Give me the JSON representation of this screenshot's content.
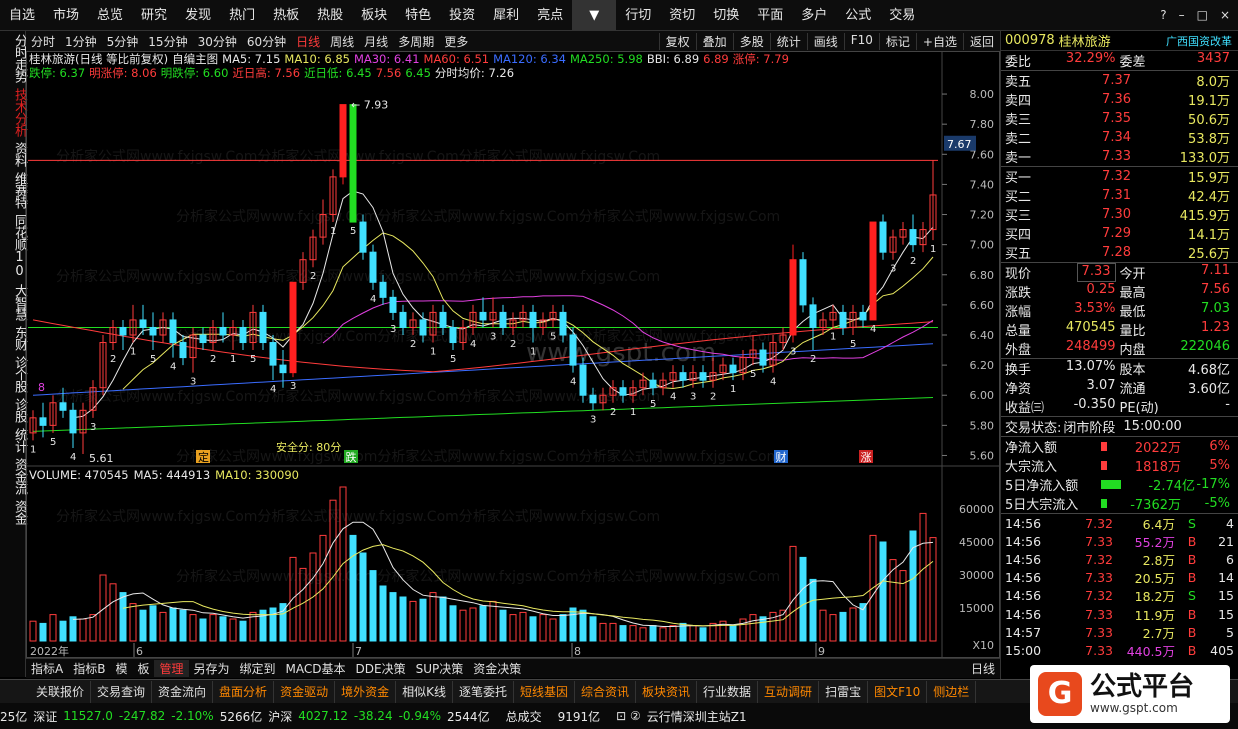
{
  "top_menu": [
    "自选",
    "市场",
    "总览",
    "研究",
    "发现",
    "热门",
    "热板",
    "热股",
    "板块",
    "特色",
    "投资",
    "犀利",
    "亮点",
    "▼",
    "行切",
    "资切",
    "切换",
    "平面",
    "多户",
    "公式",
    "交易"
  ],
  "window_controls": [
    "?",
    "–",
    "□",
    "×"
  ],
  "side_tabs": [
    "分时走势",
    "技术分析",
    "资料",
    "维赛特",
    "同花顺10",
    "大智慧",
    "东财",
    "诊个股",
    "诊股",
    "统计",
    "资金流",
    "资金"
  ],
  "period_bar": {
    "items": [
      "分时",
      "1分钟",
      "5分钟",
      "15分钟",
      "30分钟",
      "60分钟",
      "日线",
      "周线",
      "月线",
      "多周期",
      "更多"
    ],
    "active": "日线",
    "right_tools": [
      "复权",
      "叠加",
      "多股",
      "统计",
      "画线",
      "F10",
      "标记",
      "+自选",
      "返回"
    ]
  },
  "chart_info": {
    "line1": [
      {
        "t": "桂林旅游(日线 等比前复权)",
        "c": "#e8e8e8"
      },
      {
        "t": "自编主图",
        "c": "#e8e8e8"
      },
      {
        "t": "MA5: 7.15",
        "c": "#e8e8e8"
      },
      {
        "t": "MA10: 6.85",
        "c": "#e8e860"
      },
      {
        "t": "MA30: 6.41",
        "c": "#e040e0"
      },
      {
        "t": "MA60: 6.51",
        "c": "#ff3c3c"
      },
      {
        "t": "MA120: 6.34",
        "c": "#3a6cff"
      },
      {
        "t": "MA250: 5.98",
        "c": "#22dd22"
      },
      {
        "t": "BBI: 6.89",
        "c": "#e8e8e8"
      },
      {
        "t": "6.89",
        "c": "#ff3c3c"
      },
      {
        "t": "涨停: 7.79",
        "c": "#ff3c3c"
      }
    ],
    "line2": [
      {
        "t": "跌停: 6.37",
        "c": "#22dd22"
      },
      {
        "t": "明涨停: 8.06",
        "c": "#ff3c3c"
      },
      {
        "t": "明跌停: 6.60",
        "c": "#22dd22"
      },
      {
        "t": "近日高: 7.56",
        "c": "#ff3c3c"
      },
      {
        "t": "近日低: 6.45",
        "c": "#22dd22"
      },
      {
        "t": "7.56",
        "c": "#ff3c3c"
      },
      {
        "t": "6.45",
        "c": "#22dd22"
      },
      {
        "t": "分时均价: 7.26",
        "c": "#e8e8e8"
      }
    ]
  },
  "annotations": {
    "high_label": "7.93",
    "low_label": "5.61",
    "safety": "安全分: 80分",
    "diedie": "跌",
    "cai": "财",
    "zhang": "涨",
    "ding": "定",
    "plus_high": "8",
    "year": "2022年",
    "months": [
      "6",
      "7",
      "8",
      "9"
    ]
  },
  "price_axis": [
    "8.00",
    "7.80",
    "7.60",
    "7.40",
    "7.20",
    "7.00",
    "6.80",
    "6.60",
    "6.40",
    "6.20",
    "6.00",
    "5.80",
    "5.60"
  ],
  "current_price_tag": "7.67",
  "volume_axis": [
    "60000",
    "45000",
    "30000",
    "15000",
    "X10"
  ],
  "volume_legend": [
    {
      "t": "VOLUME: 470545",
      "c": "#e8e8e8"
    },
    {
      "t": "MA5: 444913",
      "c": "#e8e8e8"
    },
    {
      "t": "MA10: 330090",
      "c": "#e8e860"
    }
  ],
  "watermark_text": "分析家公式网www.fxjgsw.Com",
  "center_watermark": "www.gspt.com",
  "sub_tabs": [
    "指标A",
    "指标B",
    "模",
    "板",
    "管理",
    "另存为",
    "绑定到",
    "MACD基本",
    "DDE决策",
    "SUP决策",
    "资金决策"
  ],
  "sub_tabs_active": "管理",
  "day_label": "日线",
  "bottom_bar": [
    "关联报价",
    "交易查询",
    "资金流向",
    "盘面分析",
    "资金驱动",
    "境外资金",
    "相似K线",
    "逐笔委托",
    "短线基因",
    "综合资讯",
    "板块资讯",
    "行业数据",
    "互动调研",
    "扫雷宝",
    "图文F10",
    "侧边栏"
  ],
  "bottom_bar_highlight": [
    "盘面分析",
    "资金驱动",
    "境外资金",
    "短线基因",
    "综合资讯",
    "板块资讯",
    "互动调研",
    "图文F10",
    "侧边栏"
  ],
  "status": {
    "a": "25亿",
    "sz_label": "深证",
    "sz_val": "11527.0",
    "sz_chg": "-247.82",
    "sz_pct": "-2.10%",
    "sz_amt": "5266亿",
    "sh_label": "沪深",
    "sh_val": "4027.12",
    "sh_chg": "-38.24",
    "sh_pct": "-0.94%",
    "sh_amt": "2544亿",
    "total_label": "总成交",
    "total": "9191亿",
    "server": "云行情深圳主站Z1"
  },
  "quote": {
    "code": "000978",
    "name": "桂林旅游",
    "tag": "广西国资改革",
    "weibi_label": "委比",
    "weibi": "32.29%",
    "weicha_label": "委差",
    "weicha": "3437",
    "sell": [
      {
        "l": "卖五",
        "p": "7.37",
        "v": "8.0万"
      },
      {
        "l": "卖四",
        "p": "7.36",
        "v": "19.1万"
      },
      {
        "l": "卖三",
        "p": "7.35",
        "v": "50.6万"
      },
      {
        "l": "卖二",
        "p": "7.34",
        "v": "53.8万"
      },
      {
        "l": "卖一",
        "p": "7.33",
        "v": "133.0万"
      }
    ],
    "buy": [
      {
        "l": "买一",
        "p": "7.32",
        "v": "15.9万"
      },
      {
        "l": "买二",
        "p": "7.31",
        "v": "42.4万"
      },
      {
        "l": "买三",
        "p": "7.30",
        "v": "415.9万"
      },
      {
        "l": "买四",
        "p": "7.29",
        "v": "14.1万"
      },
      {
        "l": "买五",
        "p": "7.28",
        "v": "25.6万"
      }
    ],
    "stats": [
      {
        "a": "现价",
        "av": "7.33",
        "ac": "red",
        "b": "今开",
        "bv": "7.11",
        "bc": "red"
      },
      {
        "a": "涨跌",
        "av": "0.25",
        "ac": "red",
        "b": "最高",
        "bv": "7.56",
        "bc": "red"
      },
      {
        "a": "涨幅",
        "av": "3.53%",
        "ac": "red",
        "b": "最低",
        "bv": "7.03",
        "bc": "green"
      },
      {
        "a": "总量",
        "av": "470545",
        "ac": "yel",
        "b": "量比",
        "bv": "1.23",
        "bc": "red"
      },
      {
        "a": "外盘",
        "av": "248499",
        "ac": "red",
        "b": "内盘",
        "bv": "222046",
        "bc": "green"
      }
    ],
    "stats2": [
      {
        "a": "换手",
        "av": "13.07%",
        "b": "股本",
        "bv": "4.68亿"
      },
      {
        "a": "净资",
        "av": "3.07",
        "b": "流通",
        "bv": "3.60亿"
      },
      {
        "a": "收益㈢",
        "av": "-0.350",
        "b": "PE(动)",
        "bv": "-"
      }
    ],
    "trade_state_label": "交易状态:",
    "trade_state": "闭市阶段",
    "trade_time": "15:00:00",
    "flows": [
      {
        "l": "净流入额",
        "v": "2022万",
        "p": "6%",
        "c": "red"
      },
      {
        "l": "大宗流入",
        "v": "1818万",
        "p": "5%",
        "c": "red"
      },
      {
        "l": "5日净流入额",
        "v": "-2.74亿",
        "p": "-17%",
        "c": "green"
      },
      {
        "l": "5日大宗流入",
        "v": "-7362万",
        "p": "-5%",
        "c": "green"
      }
    ],
    "ticks": [
      {
        "t": "14:56",
        "p": "7.32",
        "v": "6.4万",
        "bs": "S",
        "n": "4"
      },
      {
        "t": "14:56",
        "p": "7.33",
        "v": "55.2万",
        "bs": "B",
        "n": "21"
      },
      {
        "t": "14:56",
        "p": "7.32",
        "v": "2.8万",
        "bs": "B",
        "n": "6"
      },
      {
        "t": "14:56",
        "p": "7.33",
        "v": "20.5万",
        "bs": "B",
        "n": "14"
      },
      {
        "t": "14:56",
        "p": "7.32",
        "v": "18.2万",
        "bs": "S",
        "n": "15"
      },
      {
        "t": "14:56",
        "p": "7.33",
        "v": "11.9万",
        "bs": "B",
        "n": "15"
      },
      {
        "t": "14:57",
        "p": "7.33",
        "v": "2.7万",
        "bs": "B",
        "n": "5"
      },
      {
        "t": "15:00",
        "p": "7.33",
        "v": "440.5万",
        "bs": "B",
        "n": "405"
      }
    ]
  },
  "watermark_brand": {
    "logo": "G",
    "name": "公式平台",
    "url": "www.gspt.com"
  },
  "chart_data": {
    "type": "candlestick",
    "ylim": [
      5.55,
      8.1
    ],
    "bars": [
      {
        "o": 5.75,
        "c": 5.85,
        "h": 5.9,
        "l": 5.7,
        "v": 9000
      },
      {
        "o": 5.85,
        "c": 5.8,
        "h": 5.95,
        "l": 5.72,
        "v": 8000
      },
      {
        "o": 5.8,
        "c": 5.95,
        "h": 6.0,
        "l": 5.75,
        "v": 12000
      },
      {
        "o": 5.95,
        "c": 5.9,
        "h": 6.05,
        "l": 5.85,
        "v": 9000
      },
      {
        "o": 5.9,
        "c": 5.75,
        "h": 5.95,
        "l": 5.65,
        "v": 11000
      },
      {
        "o": 5.75,
        "c": 5.9,
        "h": 5.95,
        "l": 5.61,
        "v": 10000
      },
      {
        "o": 5.9,
        "c": 6.05,
        "h": 6.1,
        "l": 5.85,
        "v": 12000
      },
      {
        "o": 6.05,
        "c": 6.35,
        "h": 6.4,
        "l": 6.0,
        "v": 30000
      },
      {
        "o": 6.35,
        "c": 6.45,
        "h": 6.5,
        "l": 6.3,
        "v": 26000
      },
      {
        "o": 6.45,
        "c": 6.4,
        "h": 6.5,
        "l": 6.3,
        "v": 22000
      },
      {
        "o": 6.4,
        "c": 6.5,
        "h": 6.6,
        "l": 6.35,
        "v": 17000
      },
      {
        "o": 6.5,
        "c": 6.45,
        "h": 6.6,
        "l": 6.4,
        "v": 14000
      },
      {
        "o": 6.45,
        "c": 6.4,
        "h": 6.55,
        "l": 6.3,
        "v": 16000
      },
      {
        "o": 6.4,
        "c": 6.5,
        "h": 6.55,
        "l": 6.35,
        "v": 13000
      },
      {
        "o": 6.5,
        "c": 6.35,
        "h": 6.55,
        "l": 6.25,
        "v": 15000
      },
      {
        "o": 6.35,
        "c": 6.25,
        "h": 6.4,
        "l": 6.2,
        "v": 14000
      },
      {
        "o": 6.25,
        "c": 6.4,
        "h": 6.45,
        "l": 6.15,
        "v": 12000
      },
      {
        "o": 6.4,
        "c": 6.35,
        "h": 6.45,
        "l": 6.3,
        "v": 10000
      },
      {
        "o": 6.35,
        "c": 6.45,
        "h": 6.5,
        "l": 6.3,
        "v": 12000
      },
      {
        "o": 6.45,
        "c": 6.4,
        "h": 6.55,
        "l": 6.35,
        "v": 11000
      },
      {
        "o": 6.4,
        "c": 6.45,
        "h": 6.5,
        "l": 6.3,
        "v": 10000
      },
      {
        "o": 6.45,
        "c": 6.35,
        "h": 6.5,
        "l": 6.3,
        "v": 9000
      },
      {
        "o": 6.35,
        "c": 6.55,
        "h": 6.6,
        "l": 6.3,
        "v": 13000
      },
      {
        "o": 6.55,
        "c": 6.35,
        "h": 6.6,
        "l": 6.3,
        "v": 14000
      },
      {
        "o": 6.35,
        "c": 6.2,
        "h": 6.4,
        "l": 6.1,
        "v": 15000
      },
      {
        "o": 6.2,
        "c": 6.15,
        "h": 6.3,
        "l": 6.05,
        "v": 17000
      },
      {
        "o": 6.15,
        "c": 6.75,
        "h": 6.75,
        "l": 6.12,
        "v": 38000
      },
      {
        "o": 6.75,
        "c": 6.9,
        "h": 6.95,
        "l": 6.7,
        "v": 33000
      },
      {
        "o": 6.9,
        "c": 7.05,
        "h": 7.1,
        "l": 6.85,
        "v": 40000
      },
      {
        "o": 7.05,
        "c": 7.2,
        "h": 7.3,
        "l": 7.0,
        "v": 48000
      },
      {
        "o": 7.2,
        "c": 7.45,
        "h": 7.5,
        "l": 7.15,
        "v": 64000
      },
      {
        "o": 7.45,
        "c": 7.93,
        "h": 7.93,
        "l": 7.4,
        "v": 70000
      },
      {
        "o": 7.93,
        "c": 7.15,
        "h": 7.93,
        "l": 7.15,
        "v": 48000
      },
      {
        "o": 7.15,
        "c": 6.95,
        "h": 7.2,
        "l": 6.9,
        "v": 40000
      },
      {
        "o": 6.95,
        "c": 6.75,
        "h": 7.0,
        "l": 6.7,
        "v": 32000
      },
      {
        "o": 6.75,
        "c": 6.65,
        "h": 6.8,
        "l": 6.6,
        "v": 25000
      },
      {
        "o": 6.65,
        "c": 6.55,
        "h": 6.7,
        "l": 6.5,
        "v": 22000
      },
      {
        "o": 6.55,
        "c": 6.45,
        "h": 6.6,
        "l": 6.4,
        "v": 20000
      },
      {
        "o": 6.45,
        "c": 6.5,
        "h": 6.55,
        "l": 6.4,
        "v": 18000
      },
      {
        "o": 6.5,
        "c": 6.4,
        "h": 6.55,
        "l": 6.35,
        "v": 19000
      },
      {
        "o": 6.4,
        "c": 6.55,
        "h": 6.6,
        "l": 6.35,
        "v": 22000
      },
      {
        "o": 6.55,
        "c": 6.45,
        "h": 6.6,
        "l": 6.4,
        "v": 20000
      },
      {
        "o": 6.45,
        "c": 6.35,
        "h": 6.5,
        "l": 6.3,
        "v": 16000
      },
      {
        "o": 6.35,
        "c": 6.45,
        "h": 6.5,
        "l": 6.3,
        "v": 14000
      },
      {
        "o": 6.45,
        "c": 6.55,
        "h": 6.6,
        "l": 6.4,
        "v": 15000
      },
      {
        "o": 6.55,
        "c": 6.5,
        "h": 6.65,
        "l": 6.45,
        "v": 16000
      },
      {
        "o": 6.5,
        "c": 6.55,
        "h": 6.65,
        "l": 6.45,
        "v": 18000
      },
      {
        "o": 6.55,
        "c": 6.45,
        "h": 6.6,
        "l": 6.4,
        "v": 14000
      },
      {
        "o": 6.45,
        "c": 6.5,
        "h": 6.55,
        "l": 6.4,
        "v": 12000
      },
      {
        "o": 6.5,
        "c": 6.55,
        "h": 6.6,
        "l": 6.45,
        "v": 13000
      },
      {
        "o": 6.55,
        "c": 6.45,
        "h": 6.6,
        "l": 6.35,
        "v": 11000
      },
      {
        "o": 6.45,
        "c": 6.5,
        "h": 6.55,
        "l": 6.4,
        "v": 12000
      },
      {
        "o": 6.5,
        "c": 6.55,
        "h": 6.6,
        "l": 6.45,
        "v": 10000
      },
      {
        "o": 6.55,
        "c": 6.4,
        "h": 6.6,
        "l": 6.35,
        "v": 12000
      },
      {
        "o": 6.4,
        "c": 6.2,
        "h": 6.45,
        "l": 6.15,
        "v": 15000
      },
      {
        "o": 6.2,
        "c": 6.0,
        "h": 6.25,
        "l": 5.95,
        "v": 14000
      },
      {
        "o": 6.0,
        "c": 5.95,
        "h": 6.05,
        "l": 5.9,
        "v": 11000
      },
      {
        "o": 5.95,
        "c": 6.0,
        "h": 6.05,
        "l": 5.9,
        "v": 8000
      },
      {
        "o": 6.0,
        "c": 6.05,
        "h": 6.1,
        "l": 5.95,
        "v": 8000
      },
      {
        "o": 6.05,
        "c": 6.0,
        "h": 6.1,
        "l": 5.95,
        "v": 7000
      },
      {
        "o": 6.0,
        "c": 6.05,
        "h": 6.1,
        "l": 5.95,
        "v": 7000
      },
      {
        "o": 6.05,
        "c": 6.1,
        "h": 6.15,
        "l": 6.0,
        "v": 6000
      },
      {
        "o": 6.1,
        "c": 6.05,
        "h": 6.15,
        "l": 6.0,
        "v": 7000
      },
      {
        "o": 6.05,
        "c": 6.1,
        "h": 6.15,
        "l": 6.0,
        "v": 6000
      },
      {
        "o": 6.1,
        "c": 6.15,
        "h": 6.2,
        "l": 6.05,
        "v": 7000
      },
      {
        "o": 6.15,
        "c": 6.1,
        "h": 6.2,
        "l": 6.05,
        "v": 8000
      },
      {
        "o": 6.1,
        "c": 6.15,
        "h": 6.2,
        "l": 6.05,
        "v": 7000
      },
      {
        "o": 6.15,
        "c": 6.1,
        "h": 6.2,
        "l": 6.05,
        "v": 6000
      },
      {
        "o": 6.1,
        "c": 6.15,
        "h": 6.25,
        "l": 6.05,
        "v": 8000
      },
      {
        "o": 6.15,
        "c": 6.2,
        "h": 6.25,
        "l": 6.1,
        "v": 9000
      },
      {
        "o": 6.2,
        "c": 6.15,
        "h": 6.25,
        "l": 6.1,
        "v": 7000
      },
      {
        "o": 6.15,
        "c": 6.25,
        "h": 6.3,
        "l": 6.1,
        "v": 10000
      },
      {
        "o": 6.25,
        "c": 6.3,
        "h": 6.4,
        "l": 6.2,
        "v": 12000
      },
      {
        "o": 6.3,
        "c": 6.2,
        "h": 6.35,
        "l": 6.15,
        "v": 11000
      },
      {
        "o": 6.2,
        "c": 6.35,
        "h": 6.4,
        "l": 6.15,
        "v": 13000
      },
      {
        "o": 6.35,
        "c": 6.4,
        "h": 6.45,
        "l": 6.3,
        "v": 14000
      },
      {
        "o": 6.4,
        "c": 6.9,
        "h": 7.0,
        "l": 6.35,
        "v": 43000
      },
      {
        "o": 6.9,
        "c": 6.6,
        "h": 6.95,
        "l": 6.55,
        "v": 38000
      },
      {
        "o": 6.6,
        "c": 6.45,
        "h": 6.65,
        "l": 6.3,
        "v": 28000
      },
      {
        "o": 6.45,
        "c": 6.5,
        "h": 6.55,
        "l": 6.4,
        "v": 14000
      },
      {
        "o": 6.5,
        "c": 6.55,
        "h": 6.6,
        "l": 6.45,
        "v": 12000
      },
      {
        "o": 6.55,
        "c": 6.45,
        "h": 6.6,
        "l": 6.4,
        "v": 13000
      },
      {
        "o": 6.45,
        "c": 6.55,
        "h": 6.6,
        "l": 6.4,
        "v": 15000
      },
      {
        "o": 6.55,
        "c": 6.5,
        "h": 6.6,
        "l": 6.45,
        "v": 17000
      },
      {
        "o": 6.5,
        "c": 7.15,
        "h": 7.15,
        "l": 6.5,
        "v": 48000
      },
      {
        "o": 7.15,
        "c": 6.95,
        "h": 7.2,
        "l": 6.9,
        "v": 45000
      },
      {
        "o": 6.95,
        "c": 7.05,
        "h": 7.1,
        "l": 6.9,
        "v": 37000
      },
      {
        "o": 7.05,
        "c": 7.1,
        "h": 7.15,
        "l": 7.0,
        "v": 32000
      },
      {
        "o": 7.1,
        "c": 7.0,
        "h": 7.2,
        "l": 6.95,
        "v": 50000
      },
      {
        "o": 7.0,
        "c": 7.1,
        "h": 7.15,
        "l": 6.95,
        "v": 58000
      },
      {
        "o": 7.1,
        "c": 7.33,
        "h": 7.56,
        "l": 7.03,
        "v": 47000
      }
    ],
    "ma5_color": "#e8e8e8",
    "ma10_color": "#e8e860",
    "ma30_color": "#e040e0",
    "ma60_color": "#ff3c3c",
    "ma120_color": "#3a6cff",
    "ma250_color": "#22dd22",
    "ref_lines": [
      {
        "y": 7.56,
        "color": "#ff3c3c"
      },
      {
        "y": 6.45,
        "color": "#22dd22"
      }
    ]
  }
}
